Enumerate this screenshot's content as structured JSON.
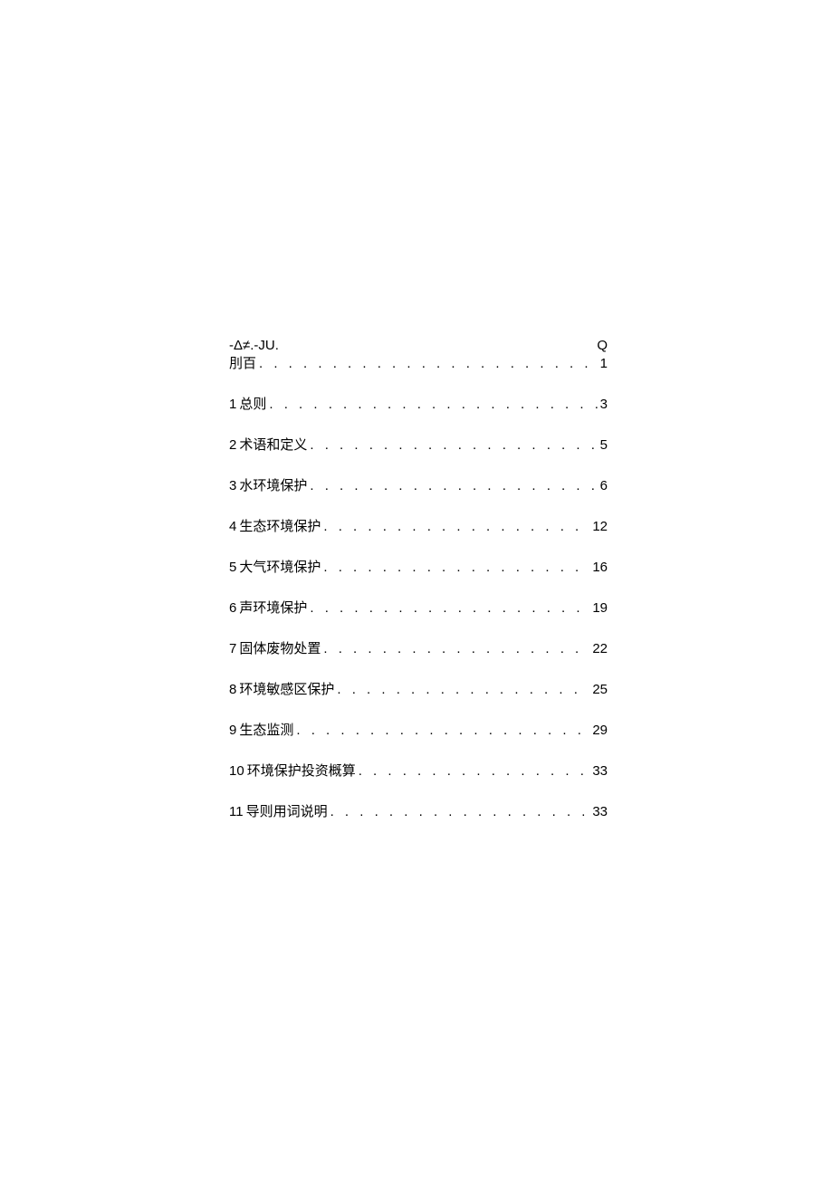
{
  "header": {
    "left_symbol": "-Δ≠.-JU.",
    "right_symbol": "Q"
  },
  "toc": [
    {
      "num": "",
      "title": "刖百",
      "page": "1"
    },
    {
      "num": "1",
      "title": "总则",
      "page": "3"
    },
    {
      "num": "2",
      "title": "术语和定义",
      "page": "5"
    },
    {
      "num": "3",
      "title": "水环境保护",
      "page": "6"
    },
    {
      "num": "4",
      "title": "生态环境保护",
      "page": "12"
    },
    {
      "num": "5",
      "title": "大气环境保护",
      "page": "16"
    },
    {
      "num": "6",
      "title": "声环境保护",
      "page": "19"
    },
    {
      "num": "7",
      "title": "固体废物处置",
      "page": "22"
    },
    {
      "num": "8",
      "title": "环境敏感区保护",
      "page": "25"
    },
    {
      "num": "9",
      "title": "生态监测",
      "page": "29"
    },
    {
      "num": "10",
      "title": "环境保护投资概算",
      "page": "33"
    },
    {
      "num": "11",
      "title": "导则用词说明",
      "page": "33"
    }
  ],
  "dot_fill": ". . . . . . . . . . . . . . . . . . . . . . . . . . . . . . . . . . . . . . . . . . . . . . . . . . . . . . . . . . . . . . . . . . . . . ."
}
